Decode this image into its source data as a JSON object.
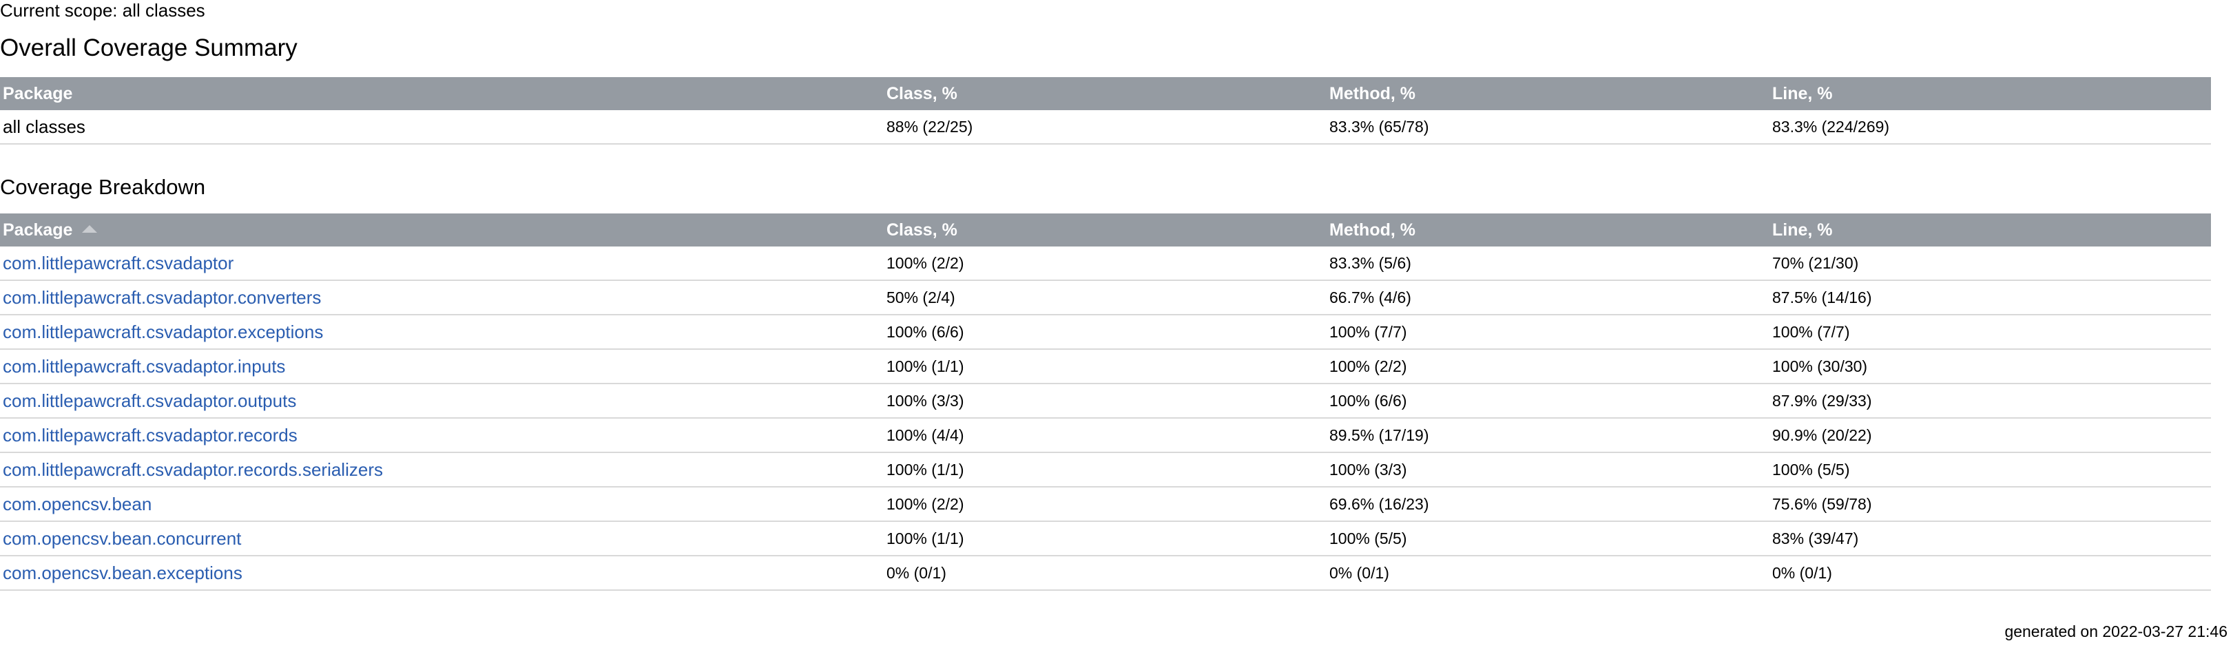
{
  "scope_text": "Current scope: all classes",
  "summary": {
    "title": "Overall Coverage Summary",
    "columns": {
      "package": "Package",
      "class": "Class, %",
      "method": "Method, %",
      "line": "Line, %"
    },
    "row": {
      "name": "all classes",
      "class": "88% (22/25)",
      "method": "83.3% (65/78)",
      "line": "83.3% (224/269)"
    }
  },
  "breakdown": {
    "title": "Coverage Breakdown",
    "sort_icon": "sort-ascending-icon",
    "columns": {
      "package": "Package",
      "class": "Class, %",
      "method": "Method, %",
      "line": "Line, %"
    },
    "rows": [
      {
        "name": "com.littlepawcraft.csvadaptor",
        "class": "100% (2/2)",
        "method": "83.3% (5/6)",
        "line": "70% (21/30)"
      },
      {
        "name": "com.littlepawcraft.csvadaptor.converters",
        "class": "50% (2/4)",
        "method": "66.7% (4/6)",
        "line": "87.5% (14/16)"
      },
      {
        "name": "com.littlepawcraft.csvadaptor.exceptions",
        "class": "100% (6/6)",
        "method": "100% (7/7)",
        "line": "100% (7/7)"
      },
      {
        "name": "com.littlepawcraft.csvadaptor.inputs",
        "class": "100% (1/1)",
        "method": "100% (2/2)",
        "line": "100% (30/30)"
      },
      {
        "name": "com.littlepawcraft.csvadaptor.outputs",
        "class": "100% (3/3)",
        "method": "100% (6/6)",
        "line": "87.9% (29/33)"
      },
      {
        "name": "com.littlepawcraft.csvadaptor.records",
        "class": "100% (4/4)",
        "method": "89.5% (17/19)",
        "line": "90.9% (20/22)"
      },
      {
        "name": "com.littlepawcraft.csvadaptor.records.serializers",
        "class": "100% (1/1)",
        "method": "100% (3/3)",
        "line": "100% (5/5)"
      },
      {
        "name": "com.opencsv.bean",
        "class": "100% (2/2)",
        "method": "69.6% (16/23)",
        "line": "75.6% (59/78)"
      },
      {
        "name": "com.opencsv.bean.concurrent",
        "class": "100% (1/1)",
        "method": "100% (5/5)",
        "line": "83% (39/47)"
      },
      {
        "name": "com.opencsv.bean.exceptions",
        "class": "0% (0/1)",
        "method": "0% (0/1)",
        "line": "0% (0/1)"
      }
    ]
  },
  "footer_text": "generated on 2022-03-27 21:46",
  "colors": {
    "header_bg": "#959ba2",
    "link": "#2a5db0",
    "row_border": "#d9d9d9"
  }
}
